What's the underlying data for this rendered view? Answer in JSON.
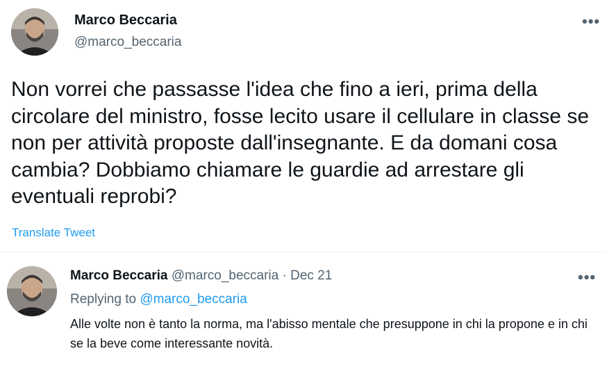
{
  "main_tweet": {
    "author_name": "Marco Beccaria",
    "author_handle": "@marco_beccaria",
    "more_icon": "•••",
    "text": "Non vorrei che passasse l'idea che fino a ieri, prima della circolare del ministro, fosse lecito usare il cellulare in classe se non per attività proposte dall'insegnante. E da domani cosa cambia? Dobbiamo chiamare le guardie ad arrestare gli eventuali reprobi?",
    "translate_label": "Translate Tweet"
  },
  "reply_tweet": {
    "author_name": "Marco Beccaria",
    "author_handle": "@marco_beccaria",
    "separator": "·",
    "date": "Dec 21",
    "more_icon": "•••",
    "replying_prefix": "Replying to",
    "replying_handle": "@marco_beccaria",
    "text": "Alle volte non è tanto la norma, ma l'abisso mentale che presuppone in chi la propone e in chi se la beve come interessante novità."
  },
  "colors": {
    "text_primary": "#0f1419",
    "text_secondary": "#536471",
    "link": "#1d9bf0"
  }
}
